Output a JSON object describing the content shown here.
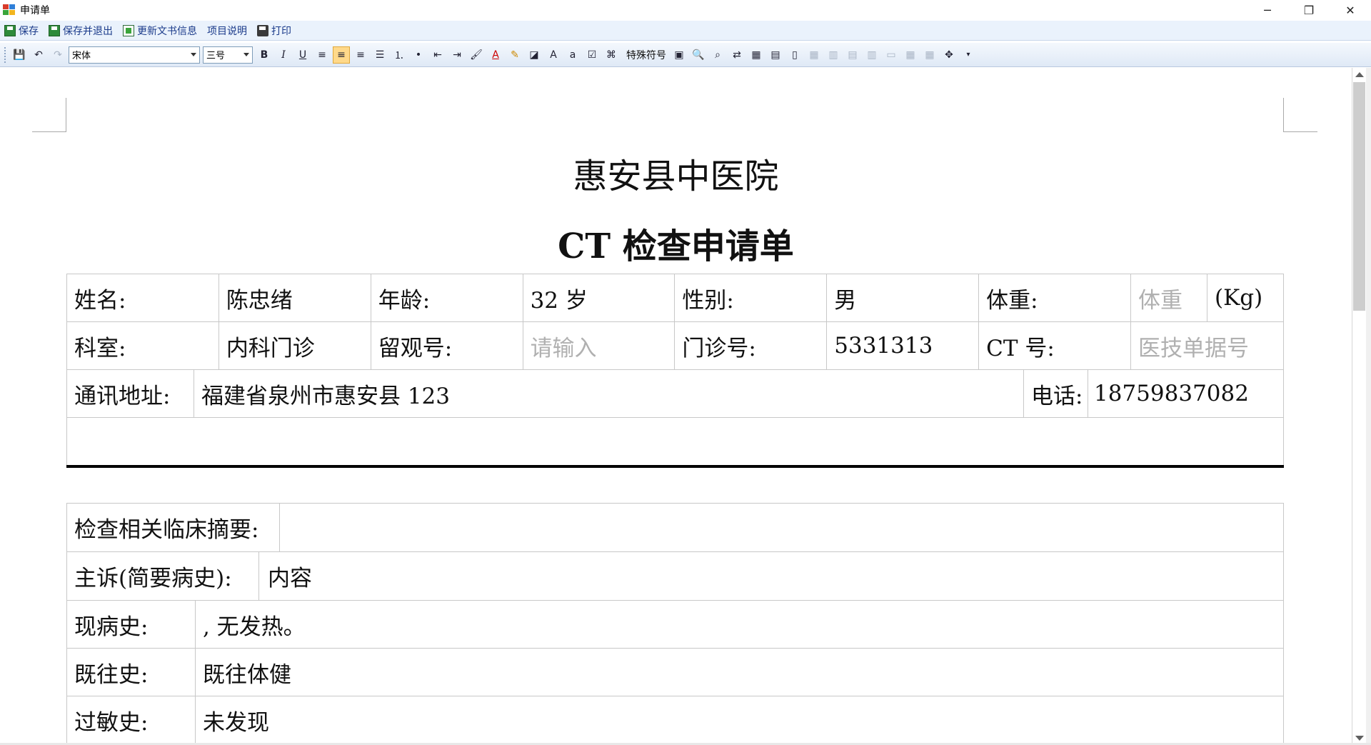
{
  "window": {
    "title": "申请单",
    "controls": {
      "minimize": "─",
      "restore": "❐",
      "close": "✕"
    }
  },
  "menubar": {
    "items": [
      {
        "label": "保存",
        "icon": "save-icon"
      },
      {
        "label": "保存并退出",
        "icon": "save-icon"
      },
      {
        "label": "更新文书信息",
        "icon": "refresh-doc-icon"
      },
      {
        "label": "项目说明",
        "icon": ""
      },
      {
        "label": "打印",
        "icon": "printer-icon"
      }
    ]
  },
  "toolbar": {
    "font_name": "宋体",
    "font_size": "三号",
    "bold": "B",
    "italic": "I",
    "underline": "U",
    "special_chars": "特殊符号"
  },
  "document": {
    "hospital_name": "惠安县中医院",
    "form_title": "CT 检查申请单",
    "patient": {
      "name_label": "姓名:",
      "name": "陈忠绪",
      "age_label": "年龄:",
      "age": "32 岁",
      "sex_label": "性别:",
      "sex": "男",
      "weight_label": "体重:",
      "weight_placeholder": "体重",
      "weight_unit": "(Kg)",
      "dept_label": "科室:",
      "dept": "内科门诊",
      "obs_label": "留观号:",
      "obs_placeholder": "请输入",
      "outpatient_label": "门诊号:",
      "outpatient_no": "5331313",
      "ct_label": "CT 号:",
      "ct_placeholder": "医技单据号",
      "address_label": "通讯地址:",
      "address": "福建省泉州市惠安县 123",
      "phone_label": "电话:",
      "phone": "18759837082"
    },
    "history": {
      "summary_label": "检查相关临床摘要:",
      "summary": "",
      "complaint_label": "主诉(简要病史):",
      "complaint": "内容",
      "present_label": "现病史:",
      "present": ", 无发热。",
      "past_label": "既往史:",
      "past": "既往体健",
      "allergy_label": "过敏史:",
      "allergy": "未发现"
    }
  }
}
